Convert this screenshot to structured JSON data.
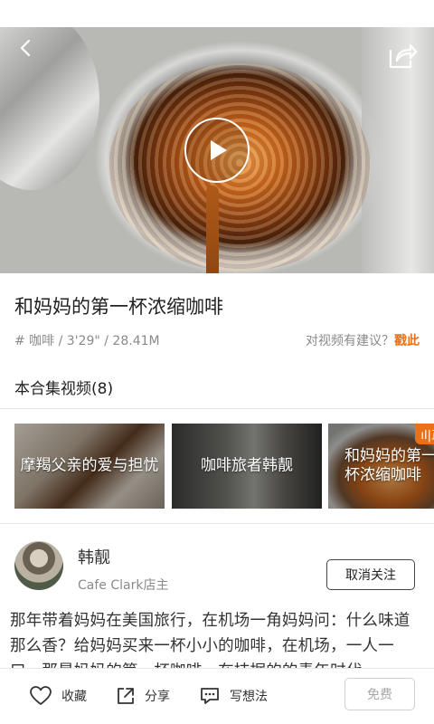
{
  "video": {
    "title": "和妈妈的第一杯浓缩咖啡",
    "meta": "# 咖啡 / 3'29\" / 28.41M",
    "suggest_prefix": "对视频有建议？",
    "suggest_link": "戳此"
  },
  "collection": {
    "heading": "本合集视频(8)",
    "items": [
      {
        "label": "摩羯父亲的爱与担忧"
      },
      {
        "label": "咖啡旅者韩靓"
      },
      {
        "label": "和妈妈的第一杯浓缩咖啡",
        "badge": "ıl|正"
      }
    ]
  },
  "author": {
    "name": "韩靓",
    "role": "Cafe Clark店主",
    "follow_label": "取消关注"
  },
  "description": "那年带着妈妈在美国旅行，在机场一角妈妈问：什么味道那么香？给妈妈买来一杯小小的咖啡，在机场，一人一口。那是妈妈的第一杯咖啡，在拮据的的青年时代",
  "bottom_bar": {
    "favorite_label": "收藏",
    "share_label": "分享",
    "comment_label": "写想法",
    "free_label": "免费"
  },
  "colors": {
    "accent": "#e8711a",
    "text": "#222222",
    "muted": "#8a8a8a"
  }
}
